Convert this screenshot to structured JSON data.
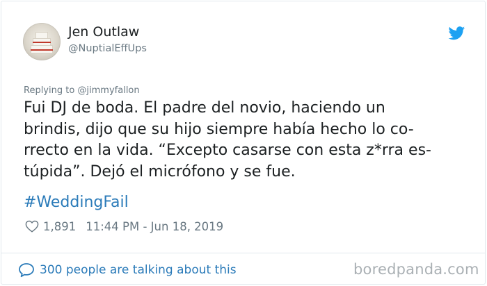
{
  "author": {
    "display_name": "Jen Outlaw",
    "handle": "@NuptialEffUps"
  },
  "tweet": {
    "replying_to": "Replying to @jimmyfallon",
    "text_lines": [
      "Fui DJ de boda. El padre del novio, haciendo un",
      "brindis, dijo que su hijo siempre había hecho lo co-",
      "rrecto en la vida. “Excepto casarse con esta z*rra es-",
      "túpida”. Dejó el micrófono y se fue."
    ],
    "hashtag": "#WeddingFail",
    "likes": "1,891",
    "timestamp": "11:44 PM - Jun 18, 2019"
  },
  "footer": {
    "talking": "300 people are talking about this",
    "watermark": "boredpanda.com"
  },
  "colors": {
    "link_blue": "#2b7bb9",
    "twitter_blue": "#1da1f2",
    "muted_gray": "#697882",
    "text": "#1c2022"
  },
  "icons": {
    "twitter_logo": "twitter-bird-icon",
    "like": "heart-icon",
    "conversation": "speech-bubble-icon"
  }
}
